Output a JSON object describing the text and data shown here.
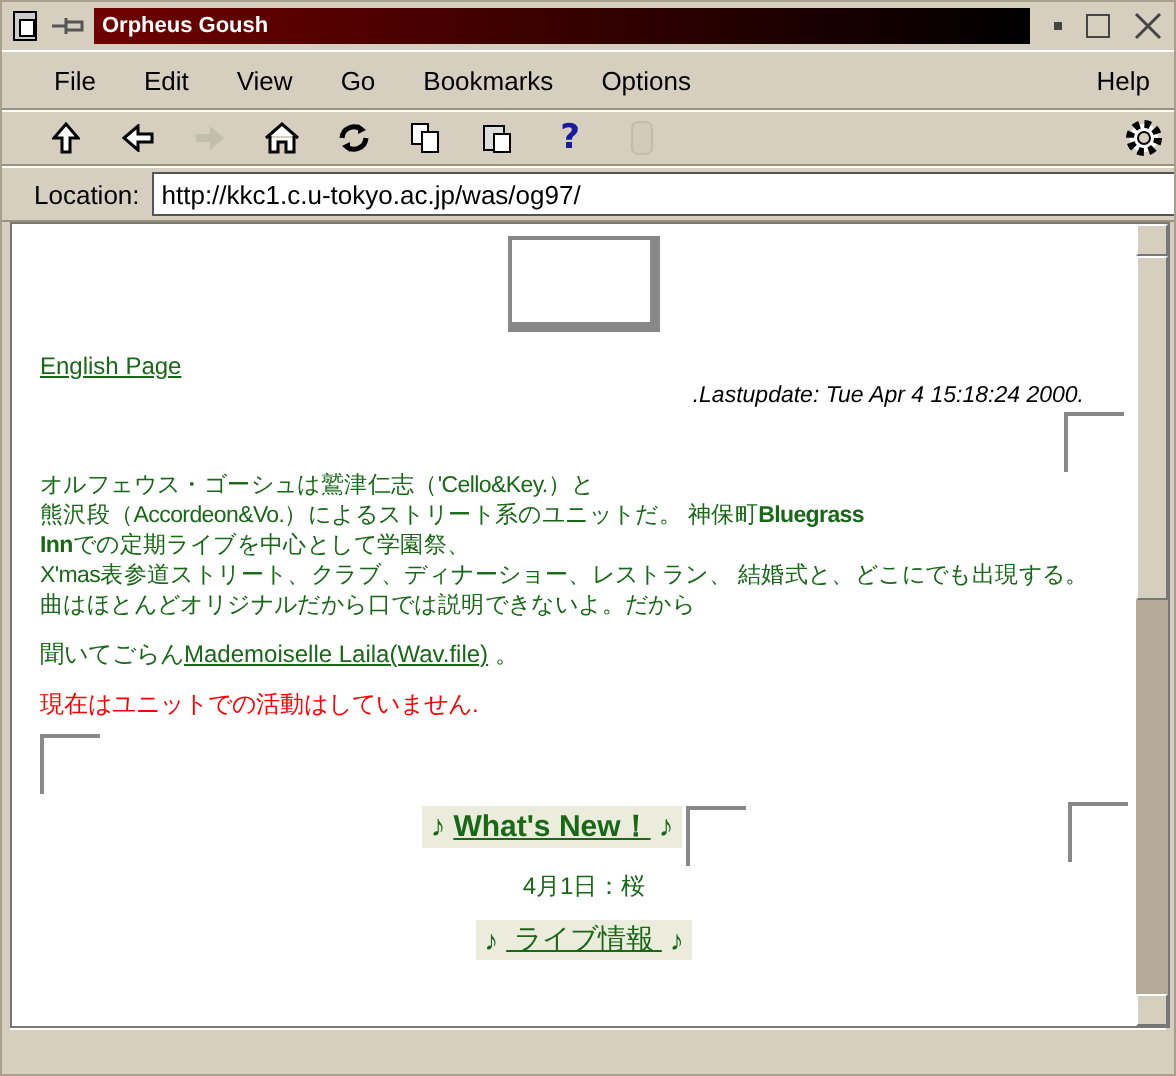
{
  "window": {
    "title": "Orpheus Goush"
  },
  "menu": [
    {
      "label": "File"
    },
    {
      "label": "Edit"
    },
    {
      "label": "View"
    },
    {
      "label": "Go"
    },
    {
      "label": "Bookmarks"
    },
    {
      "label": "Options"
    },
    {
      "label": "Help"
    }
  ],
  "toolbar": [
    {
      "kind": "up",
      "disabled": false
    },
    {
      "kind": "back",
      "disabled": false
    },
    {
      "kind": "forward",
      "disabled": true
    },
    {
      "kind": "home",
      "disabled": false
    },
    {
      "kind": "reload",
      "disabled": false
    },
    {
      "kind": "copy",
      "disabled": false
    },
    {
      "kind": "paste",
      "disabled": false
    },
    {
      "kind": "help",
      "label": "?",
      "disabled": false
    },
    {
      "kind": "stop",
      "disabled": true
    }
  ],
  "location": {
    "label": "Location:",
    "value": "http://kkc1.c.u-tokyo.ac.jp/was/og97/"
  },
  "page": {
    "english_link": "English Page",
    "last_update": ".Lastupdate: Tue Apr 4 15:18:24 2000.",
    "intro_lines": [
      "オルフェウス・ゴーシュは鷲津仁志（'Cello&Key.）と",
      "熊沢段（Accordeon&Vo.）によるストリート系のユニットだ。 神保町**Bluegrass**",
      "**Inn**での定期ライブを中心として学園祭、",
      "X'mas表参道ストリート、クラブ、ディナーショー、レストラン、 結婚式と、どこにでも出現する。",
      "曲はほとんどオリジナルだから口では説明できないよ。だから"
    ],
    "listen": {
      "before": "聞いてごらん",
      "link": "Mademoiselle Laila(Wav.file)",
      "after": " 。"
    },
    "notice": "現在はユニットでの活動はしていません.",
    "sections": [
      {
        "note_left": "♪",
        "title": "What's New！",
        "note_right": "♪",
        "bold": true,
        "items": [
          "4月1日：桜"
        ]
      },
      {
        "note_left": "♪",
        "title": " ライブ情報 ",
        "note_right": "♪",
        "bold": false
      }
    ]
  }
}
